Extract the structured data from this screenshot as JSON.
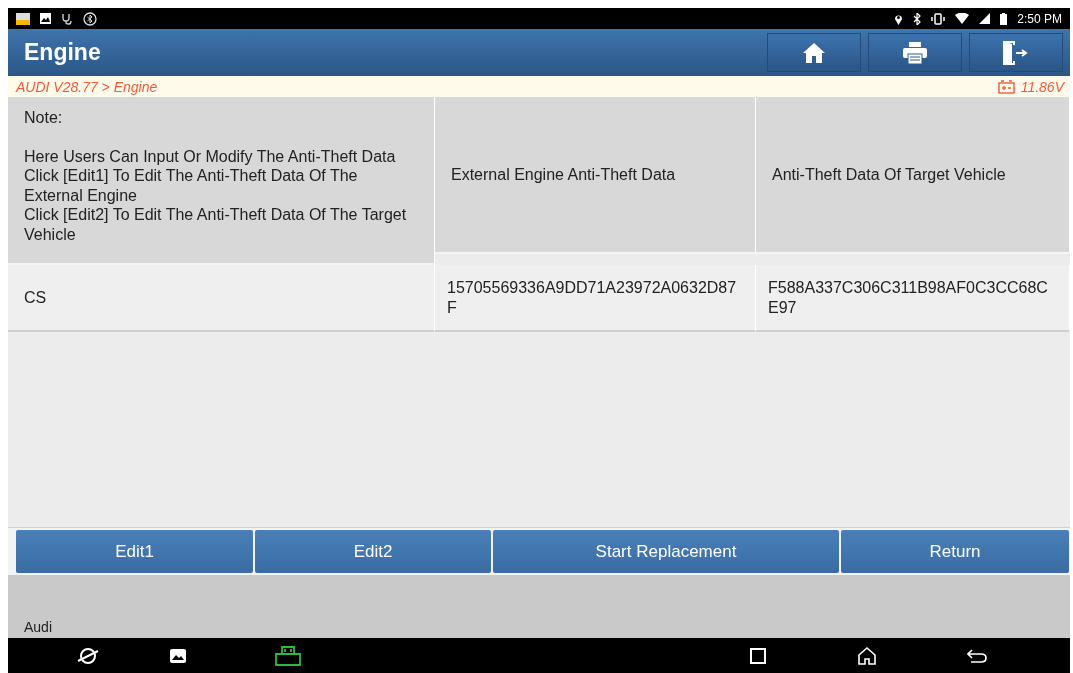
{
  "status_bar": {
    "time": "2:50 PM"
  },
  "header": {
    "title": "Engine"
  },
  "breadcrumb": {
    "path": "AUDI V28.77 > Engine",
    "voltage": "11.86V"
  },
  "table": {
    "note": {
      "title": "Note:",
      "lines": [
        "Here Users Can Input Or Modify The Anti-Theft Data",
        "Click [Edit1] To Edit The Anti-Theft Data Of The External Engine",
        "Click [Edit2] To Edit The Anti-Theft Data Of The Target Vehicle"
      ]
    },
    "columns": [
      "External Engine Anti-Theft Data",
      "Anti-Theft Data Of Target Vehicle"
    ],
    "rows": [
      {
        "label": "CS",
        "values": [
          "15705569336A9DD71A23972A0632D87F",
          "F588A337C306C311B98AF0C3CC68CE97"
        ]
      }
    ]
  },
  "buttons": [
    "Edit1",
    "Edit2",
    "Start Replacement",
    "Return"
  ],
  "footer": {
    "text": "Audi"
  }
}
